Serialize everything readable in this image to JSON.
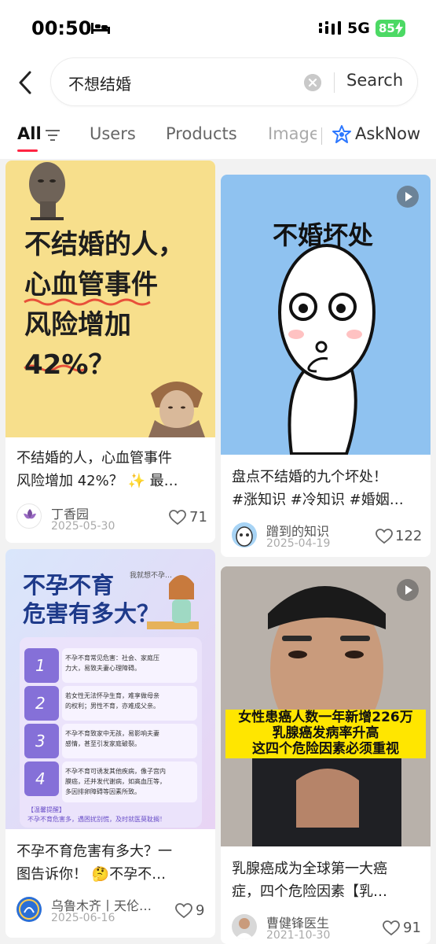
{
  "status_bar": {
    "time": "00:50",
    "network": "5G",
    "battery": "85",
    "icons": [
      "bed-icon",
      "signal-icon",
      "battery-icon"
    ]
  },
  "search": {
    "query": "不想结婚",
    "button_label": "Search",
    "icons": [
      "back-icon",
      "clear-icon"
    ]
  },
  "tabs": {
    "all": "All",
    "users": "Users",
    "products": "Products",
    "images": "Images",
    "asknow": "AskNow"
  },
  "accent_color": "#ff2442",
  "cards": [
    {
      "cover": {
        "line1": "不结婚的人，",
        "line2": "心血管事件",
        "line3": "风险增加",
        "line4": "42%？"
      },
      "title_line1": "不结婚的人，心血管事件",
      "title_line2": "风险增加 42%？ ✨ 最…",
      "author": "丁香园",
      "avatar_text": "丁香园",
      "date": "2025-05-30",
      "likes": "71"
    },
    {
      "cover": {
        "text": "不婚坏处"
      },
      "title_line1": "盘点不结婚的九个坏处！",
      "title_line2": "#涨知识 #冷知识 #婚姻…",
      "author": "蹭到的知识",
      "date": "2025-04-19",
      "likes": "122"
    },
    {
      "cover": {
        "heading1": "不孕不育",
        "heading2": "危害有多大？",
        "bubble": "我就想不孕…",
        "items": [
          {
            "num": "1",
            "line1": "不孕不育常见危害：社会、家庭压",
            "line2": "力大，易致夫妻心理障碍。"
          },
          {
            "num": "2",
            "line1": "若女性无法怀孕生育，难享做母亲",
            "line2": "的权利；男性不育，亦难成父亲。"
          },
          {
            "num": "3",
            "line1": "不孕不育致家中无孩，易影响夫妻",
            "line2": "感情，甚至引发家庭破裂。"
          },
          {
            "num": "4",
            "line1": "不孕不育可诱发其他疾病，像子宫内",
            "line2": "膜癌，还并发代谢病，如高血压等，",
            "line3": "多因排卵障碍等因素所致。"
          }
        ],
        "tip_label": "【温馨提醒】",
        "tip_text": "不孕不育危害多，遇困扰别慌，及时就医莫耽搁！"
      },
      "title_line1": "不孕不育危害有多大？一",
      "title_line2": "图告诉你！ 🤔不孕不…",
      "author": "乌鲁木齐丨天伦…",
      "date": "2025-06-16",
      "likes": "9"
    },
    {
      "cover": {
        "caption1": "女性患癌人数一年新增226万",
        "caption2": "乳腺癌发病率升高",
        "caption3": "这四个危险因素必须重视"
      },
      "title_line1": "乳腺癌成为全球第一大癌",
      "title_line2": "症，四个危险因素【乳…",
      "author": "曹健锋医生",
      "date": "2021-10-30",
      "likes": "91"
    }
  ]
}
